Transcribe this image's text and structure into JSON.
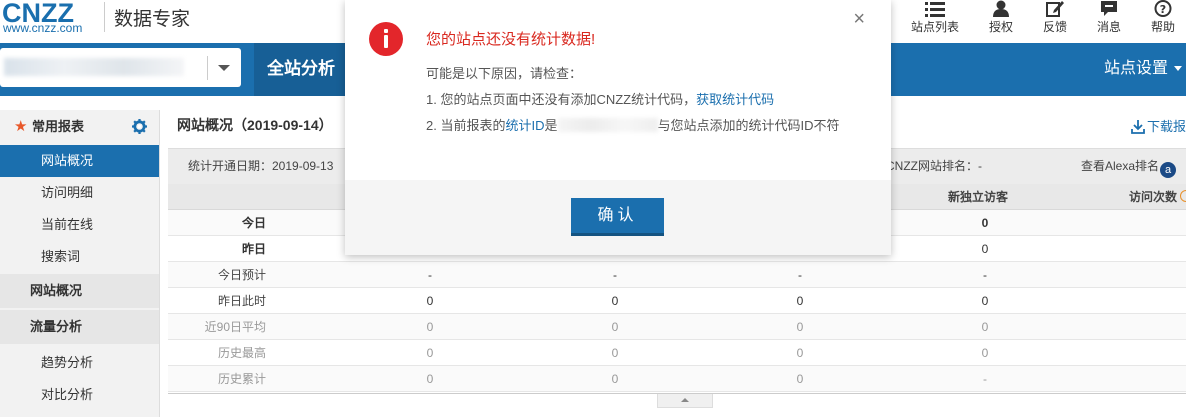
{
  "header": {
    "brand": "CNZZ",
    "url": "www.cnzz.com",
    "product": "数据专家",
    "nav": [
      {
        "label": "站点列表",
        "icon": "list-icon"
      },
      {
        "label": "授权",
        "icon": "user-icon"
      },
      {
        "label": "反馈",
        "icon": "edit-icon"
      },
      {
        "label": "消息",
        "icon": "message-icon"
      },
      {
        "label": "帮助",
        "icon": "help-icon"
      }
    ]
  },
  "bluebar": {
    "tab_all": "全站分析",
    "site_settings": "站点设置"
  },
  "sidebar": {
    "common": "常用报表",
    "items_common": [
      "网站概况",
      "访问明细",
      "当前在线",
      "搜索词"
    ],
    "group_overview": "网站概况",
    "group_traffic": "流量分析",
    "items_traffic": [
      "趋势分析",
      "对比分析"
    ]
  },
  "content": {
    "title": "网站概况（2019-09-14）",
    "download": "下载报",
    "open_date": "统计开通日期：2019-09-13",
    "rank": "CNZZ网站排名：-",
    "alexa": "查看Alexa排名",
    "alexa_badge": "a"
  },
  "table": {
    "headers": [
      "新独立访客",
      "访问次数"
    ],
    "rows": [
      {
        "label": "今日",
        "cells": [
          "",
          "",
          "",
          "0"
        ]
      },
      {
        "label": "昨日",
        "cells": [
          "",
          "",
          "",
          "0"
        ]
      },
      {
        "label": "今日预计",
        "cells": [
          "-",
          "-",
          "-",
          "-"
        ]
      },
      {
        "label": "昨日此时",
        "cells": [
          "0",
          "0",
          "0",
          "0"
        ]
      },
      {
        "label": "近90日平均",
        "cells": [
          "0",
          "0",
          "0",
          "0"
        ]
      },
      {
        "label": "历史最高",
        "cells": [
          "0",
          "0",
          "0",
          "0"
        ]
      },
      {
        "label": "历史累计",
        "cells": [
          "0",
          "0",
          "0",
          "-"
        ]
      }
    ]
  },
  "modal": {
    "title": "您的站点还没有统计数据!",
    "intro": "可能是以下原因，请检查：",
    "line1_text": "1. 您的站点页面中还没有添加CNZZ统计代码，",
    "line1_link": "获取统计代码",
    "line2_pre": "2. 当前报表的",
    "line2_link": "统计ID",
    "line2_mid": "是",
    "line2_post": "与您站点添加的统计代码ID不符",
    "ok": "确认",
    "close": "×"
  },
  "colors": {
    "brand_blue": "#1b6fae",
    "error_red": "#e3262b"
  }
}
